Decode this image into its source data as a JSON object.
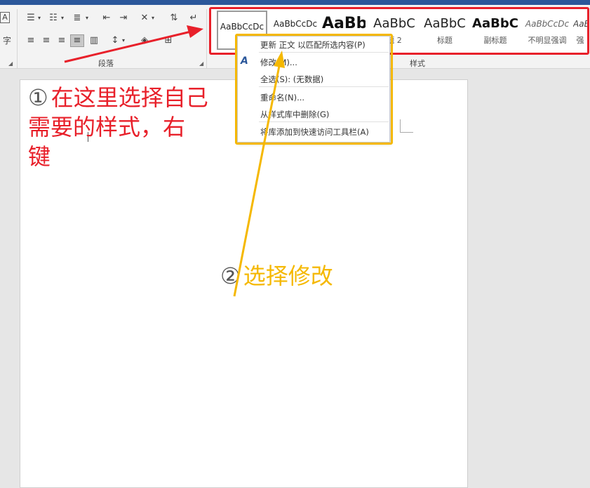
{
  "ribbon": {
    "groups": [
      {
        "label": "段落"
      },
      {
        "label": "样式"
      }
    ],
    "paragraph_icons": [
      "bullets-icon",
      "numbering-icon",
      "multilevel-list-icon",
      "decrease-indent-icon",
      "increase-indent-icon",
      "chinese-layout-icon",
      "sort-icon",
      "show-marks-icon",
      "align-left-icon",
      "align-center-icon",
      "align-right-icon",
      "justify-icon",
      "distributed-icon",
      "line-spacing-icon",
      "shading-icon",
      "borders-icon"
    ],
    "left_edge_glyphs": {
      "top": "A",
      "bottom": "字"
    }
  },
  "styles": [
    {
      "preview": "AaBbCcDc",
      "name": "↵",
      "selected": true
    },
    {
      "preview": "AaBbCcDc",
      "name": ""
    },
    {
      "preview": "AaBb",
      "name": ""
    },
    {
      "preview": "AaBbC",
      "name": "题 2"
    },
    {
      "preview": "AaBbC",
      "name": "标题"
    },
    {
      "preview": "AaBbC",
      "name": "副标题"
    },
    {
      "preview": "AaBbCcDc",
      "name": "不明显强调"
    },
    {
      "preview": "AaB",
      "name": "强"
    }
  ],
  "context_menu": {
    "items": [
      {
        "label": "更新 正文 以匹配所选内容(P)"
      },
      {
        "label": "修改(M)...",
        "icon": "modify-style-icon"
      },
      {
        "label": "全选(S): (无数据)"
      },
      {
        "label": "重命名(N)..."
      },
      {
        "label": "从样式库中删除(G)"
      },
      {
        "label": "将库添加到快速访问工具栏(A)"
      }
    ]
  },
  "annotations": {
    "step1": {
      "num": "①",
      "text": "在这里选择自己\n需要的样式，右\n键"
    },
    "step2": {
      "num": "②",
      "text": "选择修改"
    }
  },
  "colors": {
    "accent_red": "#e8202a",
    "accent_yellow": "#f5b800",
    "title_bar": "#2b579a"
  }
}
